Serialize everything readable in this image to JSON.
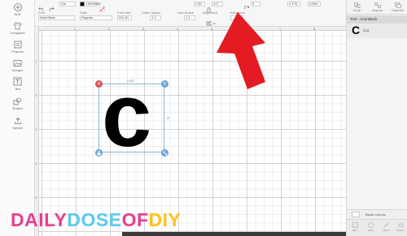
{
  "left_toolbar": {
    "items": [
      {
        "label": "New",
        "icon": "plus-icon"
      },
      {
        "label": "Templates",
        "icon": "shirt-icon"
      },
      {
        "label": "Projects",
        "icon": "projects-icon"
      },
      {
        "label": "Images",
        "icon": "image-icon"
      },
      {
        "label": "Text",
        "icon": "text-icon"
      },
      {
        "label": "Shapes",
        "icon": "shapes-icon"
      },
      {
        "label": "Upload",
        "icon": "upload-icon"
      }
    ]
  },
  "top_toolbar": {
    "operation_value": "Cut",
    "color_value": "#000000",
    "font_label": "Font",
    "font_value": "Arial Black",
    "style_label": "Style",
    "style_value": "Regular",
    "font_size_label": "Font Size",
    "font_size_value": "291.81",
    "letter_space_label": "Letter Space",
    "letter_space_value": "1.2",
    "line_space_label": "Line Space",
    "line_space_value": "1.2",
    "alignment_label": "Alignment",
    "advanced_label": "Advanced",
    "size_w_value": "2.50",
    "size_h_value": "3.0",
    "rotate_value": "0",
    "pos_x_value": "4.175",
    "pos_y_value": "3.694",
    "undo_label": "Undo",
    "linetype_label": "Linetype",
    "fill_label": "Fill"
  },
  "canvas": {
    "ruler_numbers": [
      "1",
      "2",
      "3",
      "4",
      "5",
      "6",
      "7",
      "8",
      "9"
    ],
    "ruler_left_numbers": [
      "1",
      "2",
      "3",
      "4",
      "5"
    ],
    "selection_width": "2.52\"",
    "selection_height": "3\"",
    "text_content": "c",
    "handle_delete_icon": "close-icon",
    "handle_rotate_icon": "rotate-icon",
    "handle_lock_icon": "lock-icon",
    "handle_resize_icon": "resize-icon",
    "arrow_color": "#e31b23"
  },
  "right_panel": {
    "tabs": [
      {
        "label": "Group",
        "icon": "group-icon"
      },
      {
        "label": "Ungroup",
        "icon": "ungroup-icon"
      },
      {
        "label": "Duplicate",
        "icon": "duplicate-icon"
      }
    ],
    "layer_header": "Text - Arial Black",
    "layer_glyph": "C",
    "layer_name": "Cut",
    "blank_canvas_label": "Blank Canvas",
    "bottom_items": [
      {
        "label": "Slice"
      },
      {
        "label": "Weld"
      },
      {
        "label": "Attach"
      },
      {
        "label": "Flatten"
      }
    ]
  },
  "watermark": {
    "part1": "DAILY",
    "part2": "DOSE",
    "part3": "OF",
    "part4": "DIY"
  }
}
